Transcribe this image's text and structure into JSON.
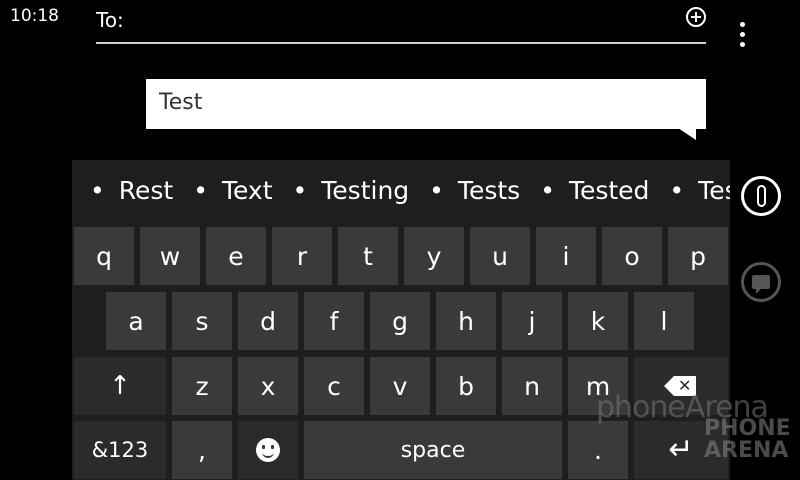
{
  "status_bar": {
    "time": "10:18"
  },
  "compose": {
    "to_label": "To:",
    "message_text": "Test"
  },
  "suggestions": [
    "Rest",
    "Text",
    "Testing",
    "Tests",
    "Tested",
    "Testimo"
  ],
  "keyboard": {
    "row1": [
      "q",
      "w",
      "e",
      "r",
      "t",
      "y",
      "u",
      "i",
      "o",
      "p"
    ],
    "row2": [
      "a",
      "s",
      "d",
      "f",
      "g",
      "h",
      "j",
      "k",
      "l"
    ],
    "row3": [
      "z",
      "x",
      "c",
      "v",
      "b",
      "n",
      "m"
    ],
    "symbols_label": "&123",
    "comma_label": ",",
    "space_label": "space",
    "period_label": "."
  },
  "watermark": {
    "line1": "phoneArena",
    "line2a": "PHONE",
    "line2b": "ARENA"
  },
  "icons": {
    "add": "add-recipient-icon",
    "more": "more-options-icon",
    "attach": "attach-icon",
    "voice": "voice-icon",
    "shift": "shift-icon",
    "backspace": "backspace-icon",
    "emoji": "emoji-icon",
    "enter": "enter-icon"
  }
}
